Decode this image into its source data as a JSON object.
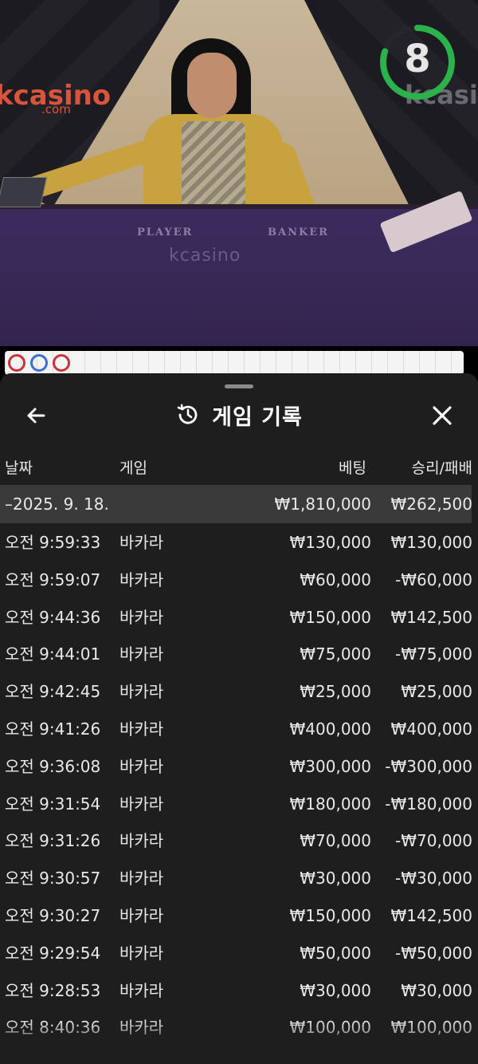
{
  "video": {
    "timer_value": "8",
    "timer_progress": 0.8,
    "brand_left": "kcasino",
    "brand_left_sub": ".com",
    "brand_right": "kcasino",
    "felt_player": "PLAYER",
    "felt_banker": "BANKER",
    "felt_logo": "kcasino"
  },
  "road": {
    "dots": [
      {
        "color": "#c8343a"
      },
      {
        "color": "#3b6fd4"
      },
      {
        "color": "#c8343a"
      }
    ]
  },
  "panel": {
    "title": "게임 기록",
    "back_icon": "arrow-left-icon",
    "close_icon": "close-icon",
    "history_icon": "history-icon",
    "columns": {
      "date": "날짜",
      "game": "게임",
      "bet": "베팅",
      "result": "승리/패배"
    },
    "date_group": {
      "label": "–2025. 9. 18.",
      "bet_total": "₩1,810,000",
      "result_total": "₩262,500"
    },
    "rows": [
      {
        "time": "오전 9:59:33",
        "game": "바카라",
        "bet": "₩130,000",
        "result": "₩130,000"
      },
      {
        "time": "오전 9:59:07",
        "game": "바카라",
        "bet": "₩60,000",
        "result": "-₩60,000"
      },
      {
        "time": "오전 9:44:36",
        "game": "바카라",
        "bet": "₩150,000",
        "result": "₩142,500"
      },
      {
        "time": "오전 9:44:01",
        "game": "바카라",
        "bet": "₩75,000",
        "result": "-₩75,000"
      },
      {
        "time": "오전 9:42:45",
        "game": "바카라",
        "bet": "₩25,000",
        "result": "₩25,000"
      },
      {
        "time": "오전 9:41:26",
        "game": "바카라",
        "bet": "₩400,000",
        "result": "₩400,000"
      },
      {
        "time": "오전 9:36:08",
        "game": "바카라",
        "bet": "₩300,000",
        "result": "-₩300,000"
      },
      {
        "time": "오전 9:31:54",
        "game": "바카라",
        "bet": "₩180,000",
        "result": "-₩180,000"
      },
      {
        "time": "오전 9:31:26",
        "game": "바카라",
        "bet": "₩70,000",
        "result": "-₩70,000"
      },
      {
        "time": "오전 9:30:57",
        "game": "바카라",
        "bet": "₩30,000",
        "result": "-₩30,000"
      },
      {
        "time": "오전 9:30:27",
        "game": "바카라",
        "bet": "₩150,000",
        "result": "₩142,500"
      },
      {
        "time": "오전 9:29:54",
        "game": "바카라",
        "bet": "₩50,000",
        "result": "-₩50,000"
      },
      {
        "time": "오전 9:28:53",
        "game": "바카라",
        "bet": "₩30,000",
        "result": "₩30,000"
      },
      {
        "time": "오전 8:40:36",
        "game": "바카라",
        "bet": "₩100,000",
        "result": "₩100,000"
      }
    ]
  }
}
